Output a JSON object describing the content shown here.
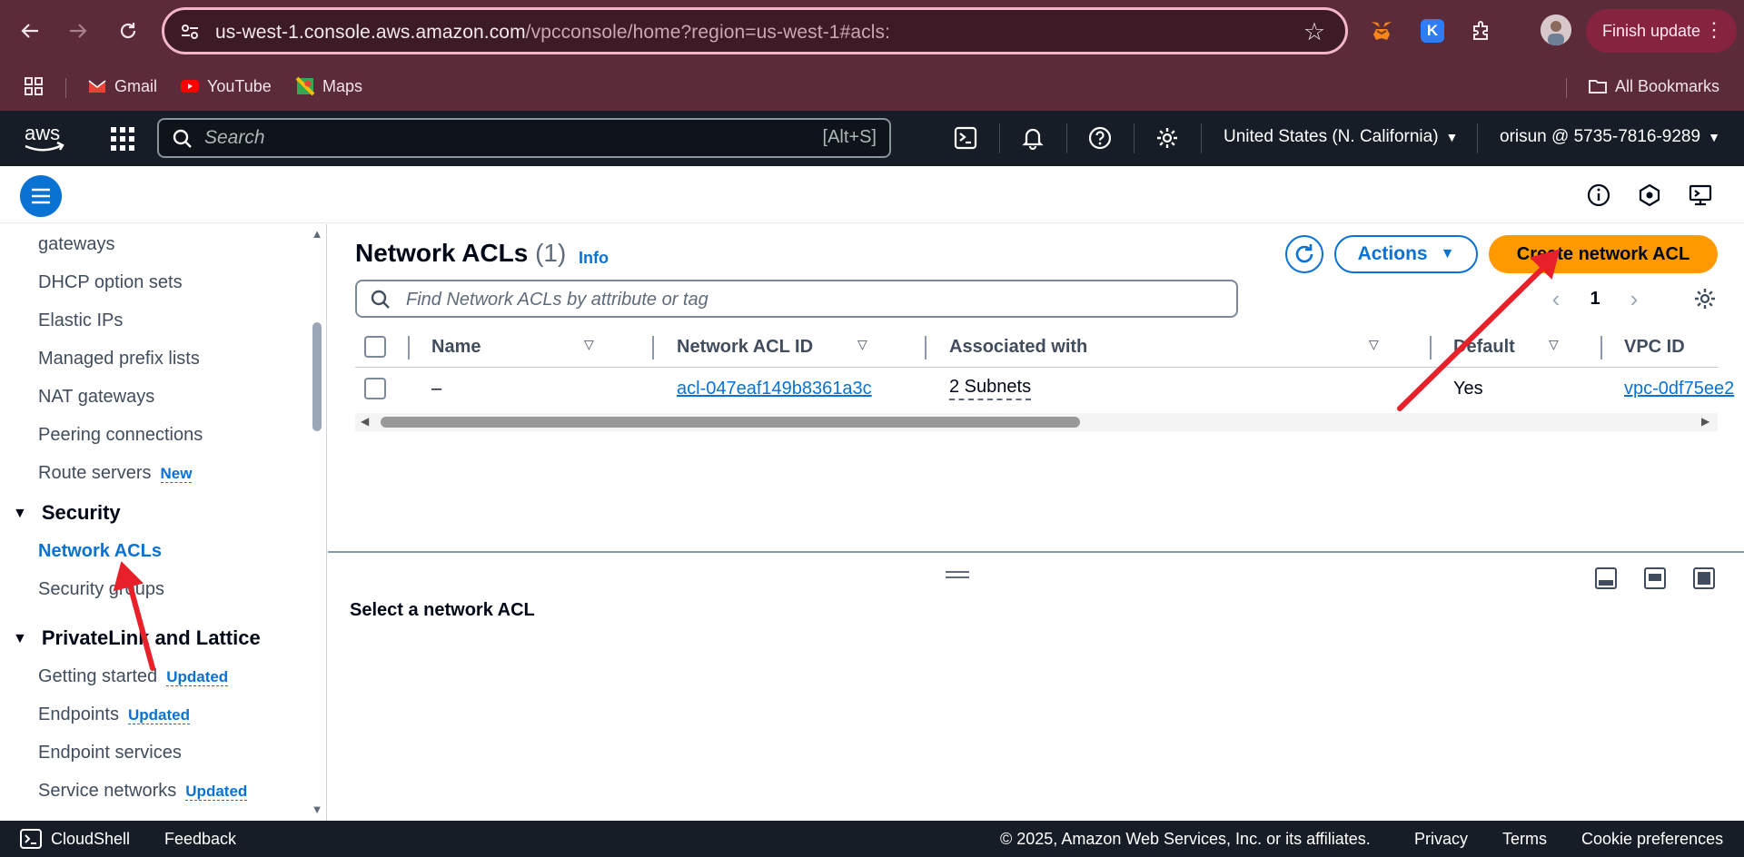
{
  "browser": {
    "url_host": "us-west-1.console.aws.amazon.com",
    "url_path": "/vpcconsole/home?region=us-west-1#acls:",
    "finish_update": "Finish update",
    "bookmarks": [
      {
        "label": "Gmail",
        "icon": "gmail-icon"
      },
      {
        "label": "YouTube",
        "icon": "youtube-icon"
      },
      {
        "label": "Maps",
        "icon": "maps-icon"
      }
    ],
    "all_bookmarks": "All Bookmarks",
    "k_extension_letter": "K"
  },
  "aws_nav": {
    "logo_text": "aws",
    "search_placeholder": "Search",
    "search_shortcut": "[Alt+S]",
    "region": "United States (N. California)",
    "account": "orisun @ 5735-7816-9289",
    "icons": [
      "cloudshell-icon",
      "bell-icon",
      "help-icon",
      "settings-icon"
    ]
  },
  "sidebar": {
    "items_top": [
      {
        "label": "gateways"
      },
      {
        "label": "DHCP option sets"
      },
      {
        "label": "Elastic IPs"
      },
      {
        "label": "Managed prefix lists"
      },
      {
        "label": "NAT gateways"
      },
      {
        "label": "Peering connections"
      },
      {
        "label": "Route servers",
        "badge": "New"
      }
    ],
    "security": {
      "heading": "Security",
      "items": [
        {
          "label": "Network ACLs",
          "active": true
        },
        {
          "label": "Security groups"
        }
      ]
    },
    "privatelink": {
      "heading": "PrivateLink and Lattice",
      "items": [
        {
          "label": "Getting started",
          "badge": "Updated"
        },
        {
          "label": "Endpoints",
          "badge": "Updated"
        },
        {
          "label": "Endpoint services"
        },
        {
          "label": "Service networks",
          "badge": "Updated"
        }
      ]
    }
  },
  "main": {
    "title": "Network ACLs",
    "count": "(1)",
    "info": "Info",
    "actions_label": "Actions",
    "create_label": "Create network ACL",
    "filter_placeholder": "Find Network ACLs by attribute or tag",
    "page_number": "1",
    "columns": [
      "Name",
      "Network ACL ID",
      "Associated with",
      "Default",
      "VPC ID"
    ],
    "rows": [
      {
        "name": "–",
        "acl_id": "acl-047eaf149b8361a3c",
        "associated": "2 Subnets",
        "default": "Yes",
        "vpc_id": "vpc-0df75ee2"
      }
    ]
  },
  "split_panel": {
    "title": "Select a network ACL"
  },
  "footer": {
    "cloudshell": "CloudShell",
    "feedback": "Feedback",
    "copyright": "© 2025, Amazon Web Services, Inc. or its affiliates.",
    "privacy": "Privacy",
    "terms": "Terms",
    "cookies": "Cookie preferences"
  },
  "colors": {
    "browser_chrome": "#5b2b3a",
    "aws_nav": "#161d26",
    "link_blue": "#0972d3",
    "primary_orange": "#ff9900",
    "annotation_red": "#e8202a"
  }
}
